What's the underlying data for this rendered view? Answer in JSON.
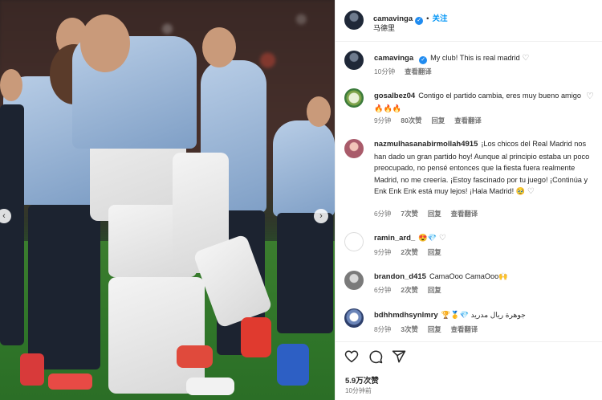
{
  "post": {
    "username": "camavinga",
    "follow_label": "关注",
    "dot": "•",
    "location": "马德里",
    "caption": "My club! This is real madrid",
    "caption_time": "10分钟",
    "caption_translate": "查看翻译"
  },
  "comments": [
    {
      "username": "gosalbez04",
      "text": "Contigo el partido cambia, eres muy bueno amigo",
      "emoji": "🔥🔥🔥",
      "time": "9分钟",
      "likes": "80次赞",
      "reply": "回复",
      "translate": "查看翻译"
    },
    {
      "username": "nazmulhasanabirmollah4915",
      "text": "¡Los chicos del Real Madrid nos han dado un gran partido hoy! Aunque al principio estaba un poco preocupado, no pensé entonces que la fiesta fuera realmente Madrid, no me creería. ¡Estoy fascinado por tu juego! ¡Continúa y Enk Enk Enk está muy lejos! ¡Hala Madrid!",
      "emoji": "🥹",
      "time": "6分钟",
      "likes": "7次赞",
      "reply": "回复",
      "translate": "查看翻译"
    },
    {
      "username": "ramin_ard_",
      "text": "",
      "emoji": "😍💎",
      "time": "9分钟",
      "likes": "2次赞",
      "reply": "回复",
      "translate": ""
    },
    {
      "username": "brandon_d415",
      "text": "CamaOoo CamaOoo",
      "emoji": "🙌",
      "time": "6分钟",
      "likes": "2次赞",
      "reply": "回复",
      "translate": ""
    },
    {
      "username": "bdhhmdhsynlmry",
      "text": "جوهرة ريال مدريد",
      "emoji": "🏆🥇💎",
      "time": "8分钟",
      "likes": "3次赞",
      "reply": "回复",
      "translate": "查看翻译"
    }
  ],
  "footer": {
    "likes": "5.9万次赞",
    "posted": "10分钟前"
  },
  "icons": {
    "like": "heart-icon",
    "comment": "comment-icon",
    "share": "share-icon",
    "carousel_prev": "chevron-left-icon",
    "carousel_next": "chevron-right-icon"
  },
  "colors": {
    "follow": "#0095f6",
    "verified": "#1f8bf0",
    "meta": "#737373"
  }
}
